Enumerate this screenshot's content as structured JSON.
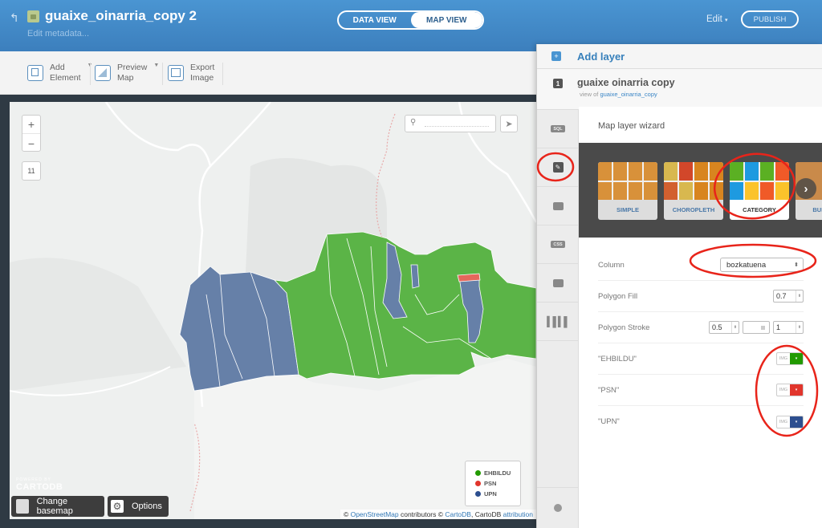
{
  "header": {
    "title": "guaixe_oinarria_copy 2",
    "edit_metadata": "Edit metadata...",
    "tabs": [
      {
        "label": "DATA VIEW",
        "active": false
      },
      {
        "label": "MAP VIEW",
        "active": true
      }
    ],
    "edit_menu": "Edit",
    "publish": "PUBLISH"
  },
  "toolbar": {
    "items": [
      {
        "line1": "Add",
        "line2": "Element",
        "has_caret": true,
        "icon": "add-element-icon"
      },
      {
        "line1": "Preview",
        "line2": "Map",
        "has_caret": true,
        "icon": "preview-map-icon"
      },
      {
        "line1": "Export",
        "line2": "Image",
        "has_caret": false,
        "icon": "export-image-icon"
      }
    ]
  },
  "map": {
    "zoom_in": "+",
    "zoom_out": "−",
    "zoom_level": "11",
    "search_placeholder": "",
    "logo_small": "POWERED BY",
    "logo_big": "CARTODB",
    "change_basemap": "Change basemap",
    "options": "Options",
    "legend": [
      {
        "label": "EHBILDU",
        "color": "#229a00"
      },
      {
        "label": "PSN",
        "color": "#e1352c"
      },
      {
        "label": "UPN",
        "color": "#2d4f8f"
      }
    ],
    "attribution": {
      "prefix": "© ",
      "osm": "OpenStreetMap",
      "mid": " contributors © ",
      "cartodb": "CartoDB",
      "mid2": ", CartoDB ",
      "attr": "attribution"
    },
    "polygon_colors": {
      "EHBILDU": "#5bb447",
      "PSN": "#e5675c",
      "UPN": "#6680a8"
    }
  },
  "panel": {
    "add_layer": "Add layer",
    "layer": {
      "number": "1",
      "name": "guaixe oinarria copy",
      "view_of_prefix": "view of",
      "view_of_link": "guaixe_oinarria_copy"
    },
    "side_tabs": [
      {
        "name": "sql-tab",
        "label": "SQL"
      },
      {
        "name": "wizard-tab",
        "label": "",
        "active": true
      },
      {
        "name": "infowindow-tab",
        "label": ""
      },
      {
        "name": "css-tab",
        "label": "CSS"
      },
      {
        "name": "legend-tab",
        "label": ""
      },
      {
        "name": "filters-tab",
        "label": ""
      }
    ],
    "wizard": {
      "title": "Map layer wizard",
      "types": [
        {
          "label": "SIMPLE",
          "active": false
        },
        {
          "label": "CHOROPLETH",
          "active": false
        },
        {
          "label": "CATEGORY",
          "active": true
        },
        {
          "label": "BUBBLE",
          "active": false
        }
      ],
      "column_label": "Column",
      "column_value": "bozkatuena",
      "polygon_fill_label": "Polygon Fill",
      "polygon_fill_value": "0.7",
      "polygon_stroke_label": "Polygon Stroke",
      "polygon_stroke_width": "0.5",
      "polygon_stroke_opacity": "1",
      "categories": [
        {
          "label": "\"EHBILDU\"",
          "img": "IMG",
          "color": "#229a00"
        },
        {
          "label": "\"PSN\"",
          "img": "IMG",
          "color": "#e1352c"
        },
        {
          "label": "\"UPN\"",
          "img": "IMG",
          "color": "#2d4f8f"
        }
      ]
    }
  }
}
